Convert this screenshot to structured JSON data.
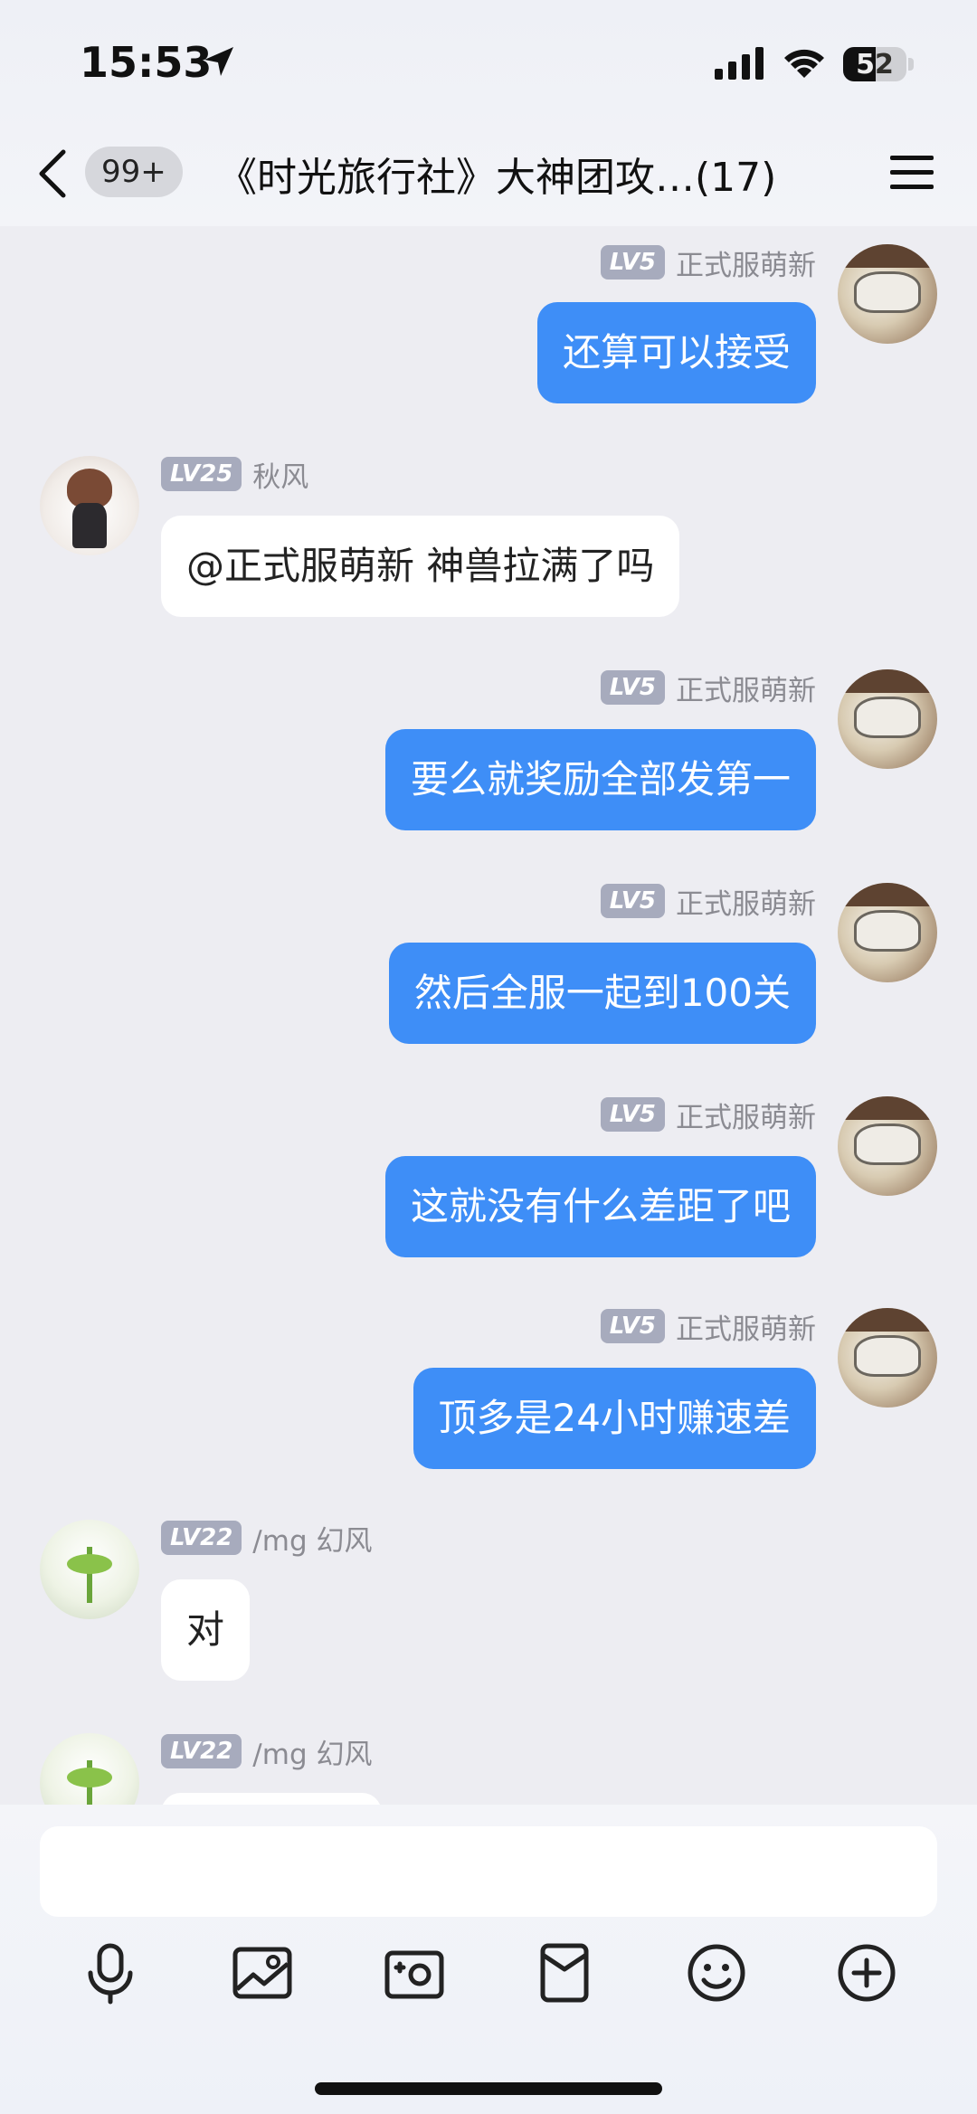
{
  "status_bar": {
    "time": "15:53",
    "battery": "52"
  },
  "header": {
    "unread_badge": "99+",
    "title": "《时光旅行社》大神团攻…(17)"
  },
  "messages": [
    {
      "side": "out",
      "level": "LV5",
      "nick": "正式服萌新",
      "text": "还算可以接受"
    },
    {
      "side": "in",
      "level": "LV25",
      "nick": "秋风",
      "text": "@正式服萌新 神兽拉满了吗"
    },
    {
      "side": "out",
      "level": "LV5",
      "nick": "正式服萌新",
      "text": "要么就奖励全部发第一"
    },
    {
      "side": "out",
      "level": "LV5",
      "nick": "正式服萌新",
      "text": "然后全服一起到100关"
    },
    {
      "side": "out",
      "level": "LV5",
      "nick": "正式服萌新",
      "text": "这就没有什么差距了吧"
    },
    {
      "side": "out",
      "level": "LV5",
      "nick": "正式服萌新",
      "text": "顶多是24小时赚速差"
    },
    {
      "side": "in",
      "level": "LV22",
      "nick": "/mg 幻风",
      "text": "对"
    },
    {
      "side": "in",
      "level": "LV22",
      "nick": "/mg 幻风",
      "text": ""
    }
  ],
  "input": {
    "placeholder": ""
  },
  "toolbar": {
    "icons": [
      "microphone-icon",
      "image-icon",
      "camera-icon",
      "red-packet-icon",
      "emoji-icon",
      "plus-icon"
    ]
  },
  "colors": {
    "outgoing_bubble": "#3e8ef7",
    "incoming_bubble": "#ffffff",
    "level_badge": "#a7abbd",
    "background": "#ededf2"
  }
}
